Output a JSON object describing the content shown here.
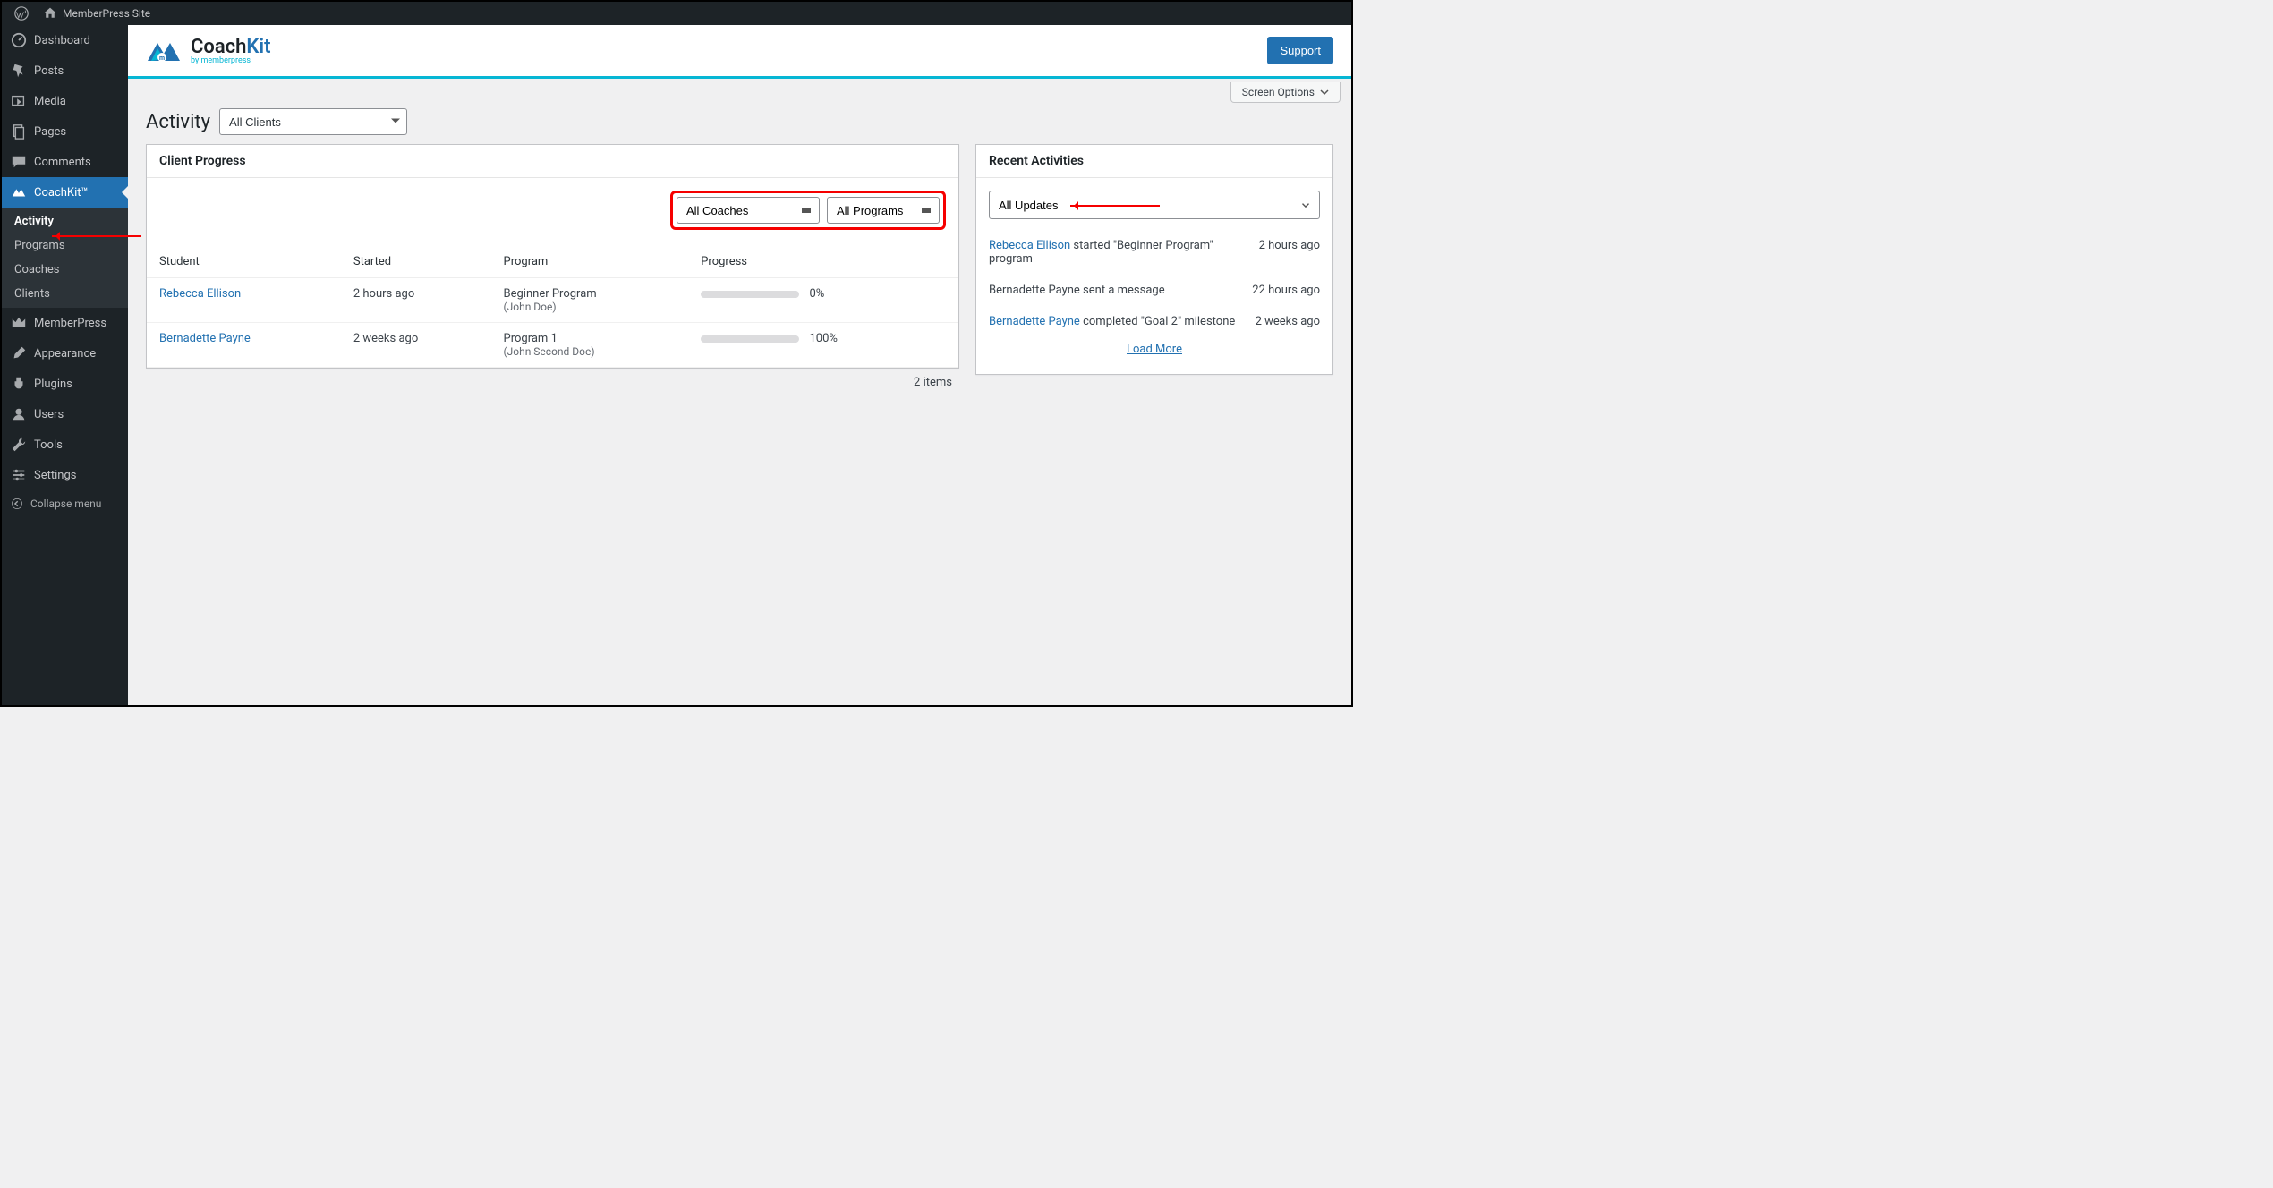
{
  "adminbar": {
    "site_name": "MemberPress Site"
  },
  "sidebar": {
    "items": [
      {
        "label": "Dashboard"
      },
      {
        "label": "Posts"
      },
      {
        "label": "Media"
      },
      {
        "label": "Pages"
      },
      {
        "label": "Comments"
      },
      {
        "label": "CoachKit™"
      },
      {
        "label": "MemberPress"
      },
      {
        "label": "Appearance"
      },
      {
        "label": "Plugins"
      },
      {
        "label": "Users"
      },
      {
        "label": "Tools"
      },
      {
        "label": "Settings"
      }
    ],
    "submenu": [
      {
        "label": "Activity",
        "current": true
      },
      {
        "label": "Programs"
      },
      {
        "label": "Coaches"
      },
      {
        "label": "Clients"
      }
    ],
    "collapse_label": "Collapse menu"
  },
  "brand": {
    "name1": "Coach",
    "name2": "Kit",
    "sub": "by memberpress",
    "support": "Support"
  },
  "screen_options": "Screen Options",
  "page": {
    "title": "Activity",
    "client_filter": "All Clients"
  },
  "client_progress": {
    "title": "Client Progress",
    "filters": {
      "coaches": "All Coaches",
      "programs": "All Programs"
    },
    "columns": {
      "student": "Student",
      "started": "Started",
      "program": "Program",
      "progress": "Progress"
    },
    "rows": [
      {
        "student": "Rebecca Ellison",
        "started": "2 hours ago",
        "program": "Beginner Program",
        "coach": "(John Doe)",
        "pct": 0,
        "pct_label": "0%"
      },
      {
        "student": "Bernadette Payne",
        "started": "2 weeks ago",
        "program": "Program 1",
        "coach": "(John Second Doe)",
        "pct": 100,
        "pct_label": "100%"
      }
    ],
    "count": "2 items"
  },
  "recent": {
    "title": "Recent Activities",
    "filter": "All Updates",
    "items": [
      {
        "link": "Rebecca Ellison",
        "text": " started \"Beginner Program\" program",
        "time": "2 hours ago"
      },
      {
        "link": "",
        "text": "Bernadette Payne sent a message",
        "time": "22 hours ago"
      },
      {
        "link": "Bernadette Payne",
        "text": " completed \"Goal 2\" milestone",
        "time": "2 weeks ago"
      }
    ],
    "load_more": "Load More"
  }
}
